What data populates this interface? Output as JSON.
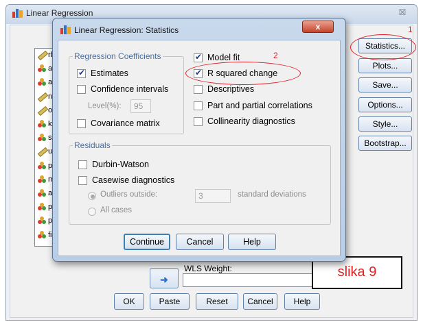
{
  "parent_window": {
    "title": "Linear Regression",
    "close_glyph": "☒",
    "variables": [
      {
        "label": "rbr",
        "icon": "scale-variable-icon"
      },
      {
        "label": "ats",
        "icon": "nominal-variable-icon"
      },
      {
        "label": "alt",
        "icon": "nominal-variable-icon"
      },
      {
        "label": "ntl",
        "icon": "scale-variable-icon"
      },
      {
        "label": "oz",
        "icon": "scale-variable-icon"
      },
      {
        "label": "kf",
        "icon": "nominal-variable-icon"
      },
      {
        "label": "stu",
        "icon": "nominal-variable-icon"
      },
      {
        "label": "uzr",
        "icon": "scale-variable-icon"
      },
      {
        "label": "pol",
        "icon": "nominal-variable-icon"
      },
      {
        "label": "ma",
        "icon": "nominal-variable-icon"
      },
      {
        "label": "am",
        "icon": "nominal-variable-icon"
      },
      {
        "label": "pit8",
        "icon": "nominal-variable-icon"
      },
      {
        "label": "pat",
        "icon": "nominal-variable-icon"
      },
      {
        "label": "filte",
        "icon": "nominal-variable-icon"
      }
    ],
    "side_buttons": {
      "statistics": "Statistics...",
      "plots": "Plots...",
      "save": "Save...",
      "options": "Options...",
      "style": "Style...",
      "bootstrap": "Bootstrap..."
    },
    "wls_weight_label": "WLS Weight:",
    "move_arrow_glyph": "➜",
    "bottom_buttons": {
      "ok": "OK",
      "paste": "Paste",
      "reset": "Reset",
      "cancel": "Cancel",
      "help": "Help"
    }
  },
  "dialog": {
    "title": "Linear Regression: Statistics",
    "close_glyph": "x",
    "regression_coefficients": {
      "legend": "Regression Coefficients",
      "estimates": {
        "label": "Estimates",
        "checked": true
      },
      "confidence_intervals": {
        "label": "Confidence intervals",
        "checked": false
      },
      "level_label": "Level(%):",
      "level_value": "95",
      "covariance_matrix": {
        "label": "Covariance matrix",
        "checked": false
      }
    },
    "right_options": {
      "model_fit": {
        "label": "Model fit",
        "checked": true
      },
      "r_squared_change": {
        "label": "R squared change",
        "checked": true
      },
      "descriptives": {
        "label": "Descriptives",
        "checked": false
      },
      "part_partial": {
        "label": "Part and partial correlations",
        "checked": false
      },
      "collinearity": {
        "label": "Collinearity diagnostics",
        "checked": false
      }
    },
    "residuals": {
      "legend": "Residuals",
      "durbin_watson": {
        "label": "Durbin-Watson",
        "checked": false
      },
      "casewise": {
        "label": "Casewise diagnostics",
        "checked": false
      },
      "outliers_label": "Outliers outside:",
      "outliers_value": "3",
      "std_dev_label": "standard deviations",
      "all_cases_label": "All cases"
    },
    "buttons": {
      "continue": "Continue",
      "cancel": "Cancel",
      "help": "Help"
    }
  },
  "annotations": {
    "number_1": "1",
    "number_2": "2",
    "caption": "slika 9",
    "color": "#e0202a"
  }
}
